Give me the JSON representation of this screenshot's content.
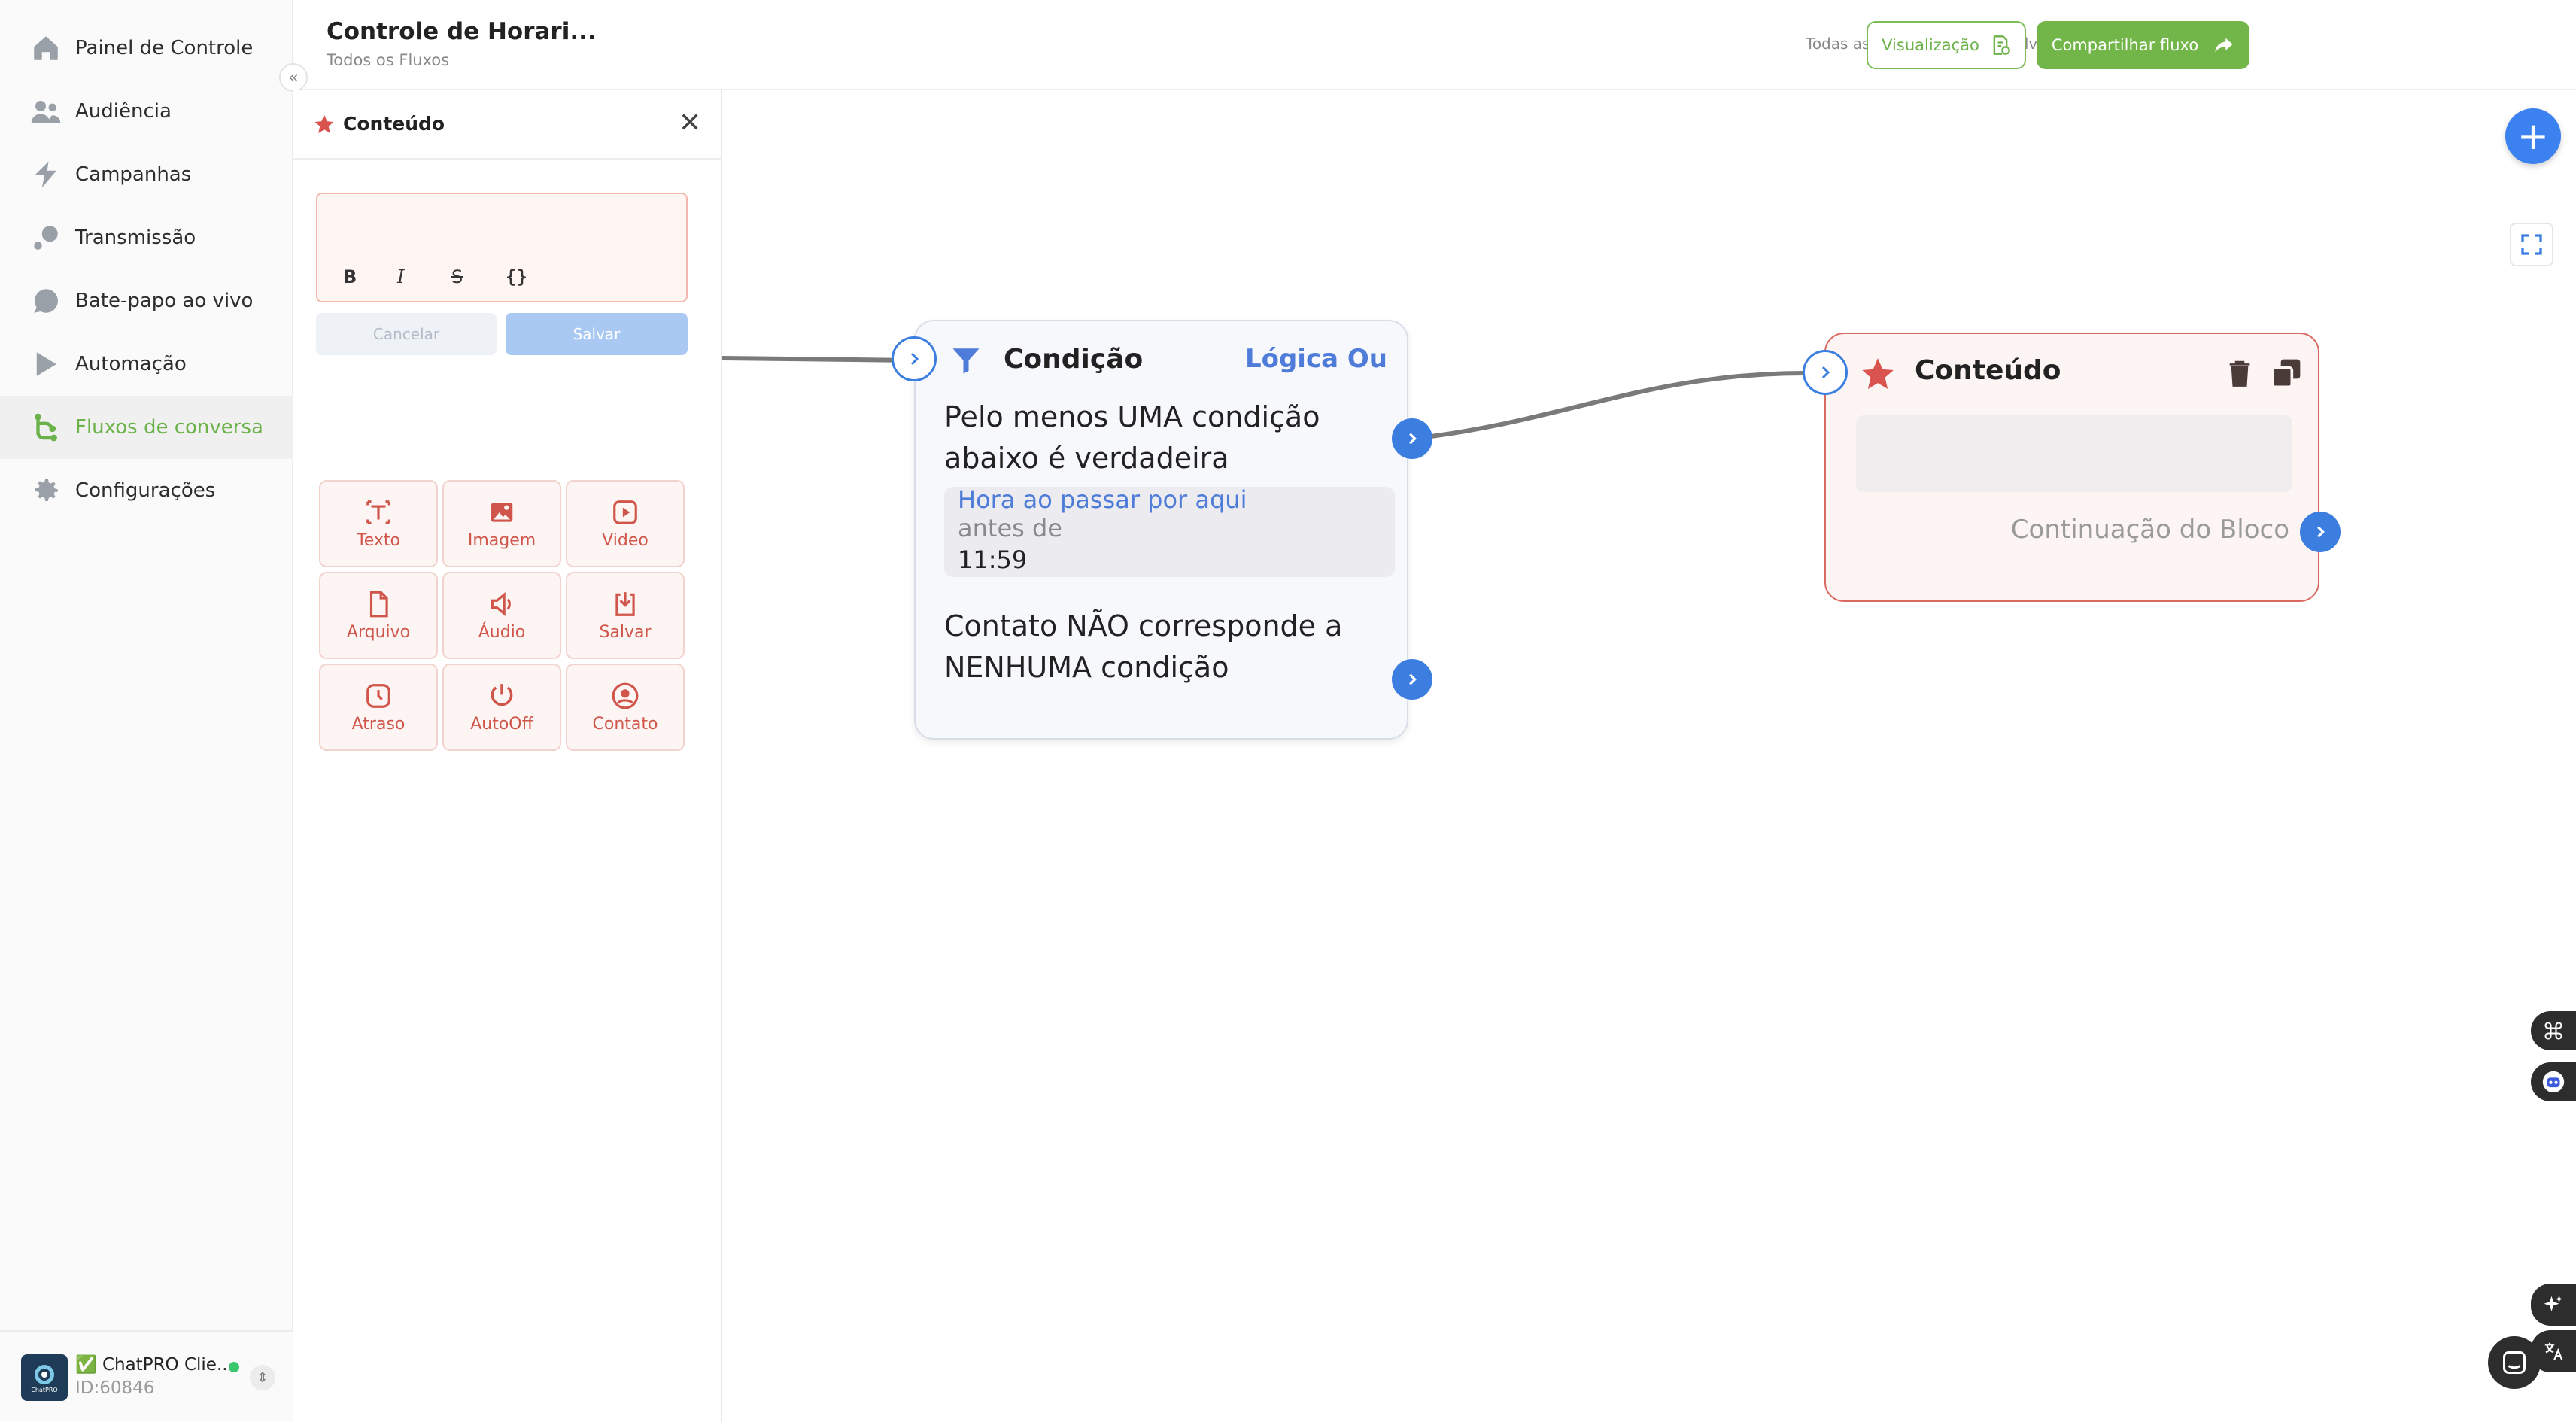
{
  "sidebar": {
    "items": [
      {
        "label": "Painel de Controle",
        "icon": "home-icon"
      },
      {
        "label": "Audiência",
        "icon": "users-icon"
      },
      {
        "label": "Campanhas",
        "icon": "campaign-icon"
      },
      {
        "label": "Transmissão",
        "icon": "broadcast-icon"
      },
      {
        "label": "Bate-papo ao vivo",
        "icon": "chat-icon"
      },
      {
        "label": "Automação",
        "icon": "automation-icon"
      },
      {
        "label": "Fluxos de conversa",
        "icon": "flow-icon"
      },
      {
        "label": "Configurações",
        "icon": "gear-icon"
      }
    ],
    "collapse_glyph": "«",
    "account": {
      "name": "✅ ChatPRO Clie...",
      "id": "ID:60846",
      "switch_glyph": "⇕",
      "logo_text": "ChatPRO"
    }
  },
  "header": {
    "title": "Controle de Horari...",
    "breadcrumb": "Todos os Fluxos",
    "autosave": "Todas as alterações foram salvas automaticamente",
    "preview_label": "Visualização",
    "share_label": "Compartilhar fluxo"
  },
  "panel": {
    "title": "Conteúdo",
    "close_glyph": "✕",
    "format_buttons": [
      "B",
      "I",
      "S",
      "{}"
    ],
    "cancel_label": "Cancelar",
    "save_label": "Salvar",
    "tiles": [
      {
        "label": "Texto",
        "icon": "text-icon"
      },
      {
        "label": "Imagem",
        "icon": "image-icon"
      },
      {
        "label": "Video",
        "icon": "video-icon"
      },
      {
        "label": "Arquivo",
        "icon": "file-icon"
      },
      {
        "label": "Áudio",
        "icon": "audio-icon"
      },
      {
        "label": "Salvar",
        "icon": "download-icon"
      },
      {
        "label": "Atraso",
        "icon": "clock-icon"
      },
      {
        "label": "AutoOff",
        "icon": "power-icon"
      },
      {
        "label": "Contato",
        "icon": "contact-icon"
      }
    ]
  },
  "canvas": {
    "condition_node": {
      "title": "Condição",
      "logic": "Lógica Ou",
      "rule_text": "Pelo menos UMA condição abaixo é verdadeira",
      "condition": {
        "field": "Hora ao passar por aqui",
        "operator": "antes de",
        "value": "11:59"
      },
      "else_text": "Contato NÃO corresponde a NENHUMA condição"
    },
    "content_node": {
      "title": "Conteúdo",
      "continuation": "Continuação do Bloco"
    },
    "add_glyph": "+",
    "colors": {
      "accent": "#3b7ee0",
      "brand_green": "#72b649",
      "content_red": "#d96a62",
      "logic_blue": "#4e7cd8"
    }
  }
}
